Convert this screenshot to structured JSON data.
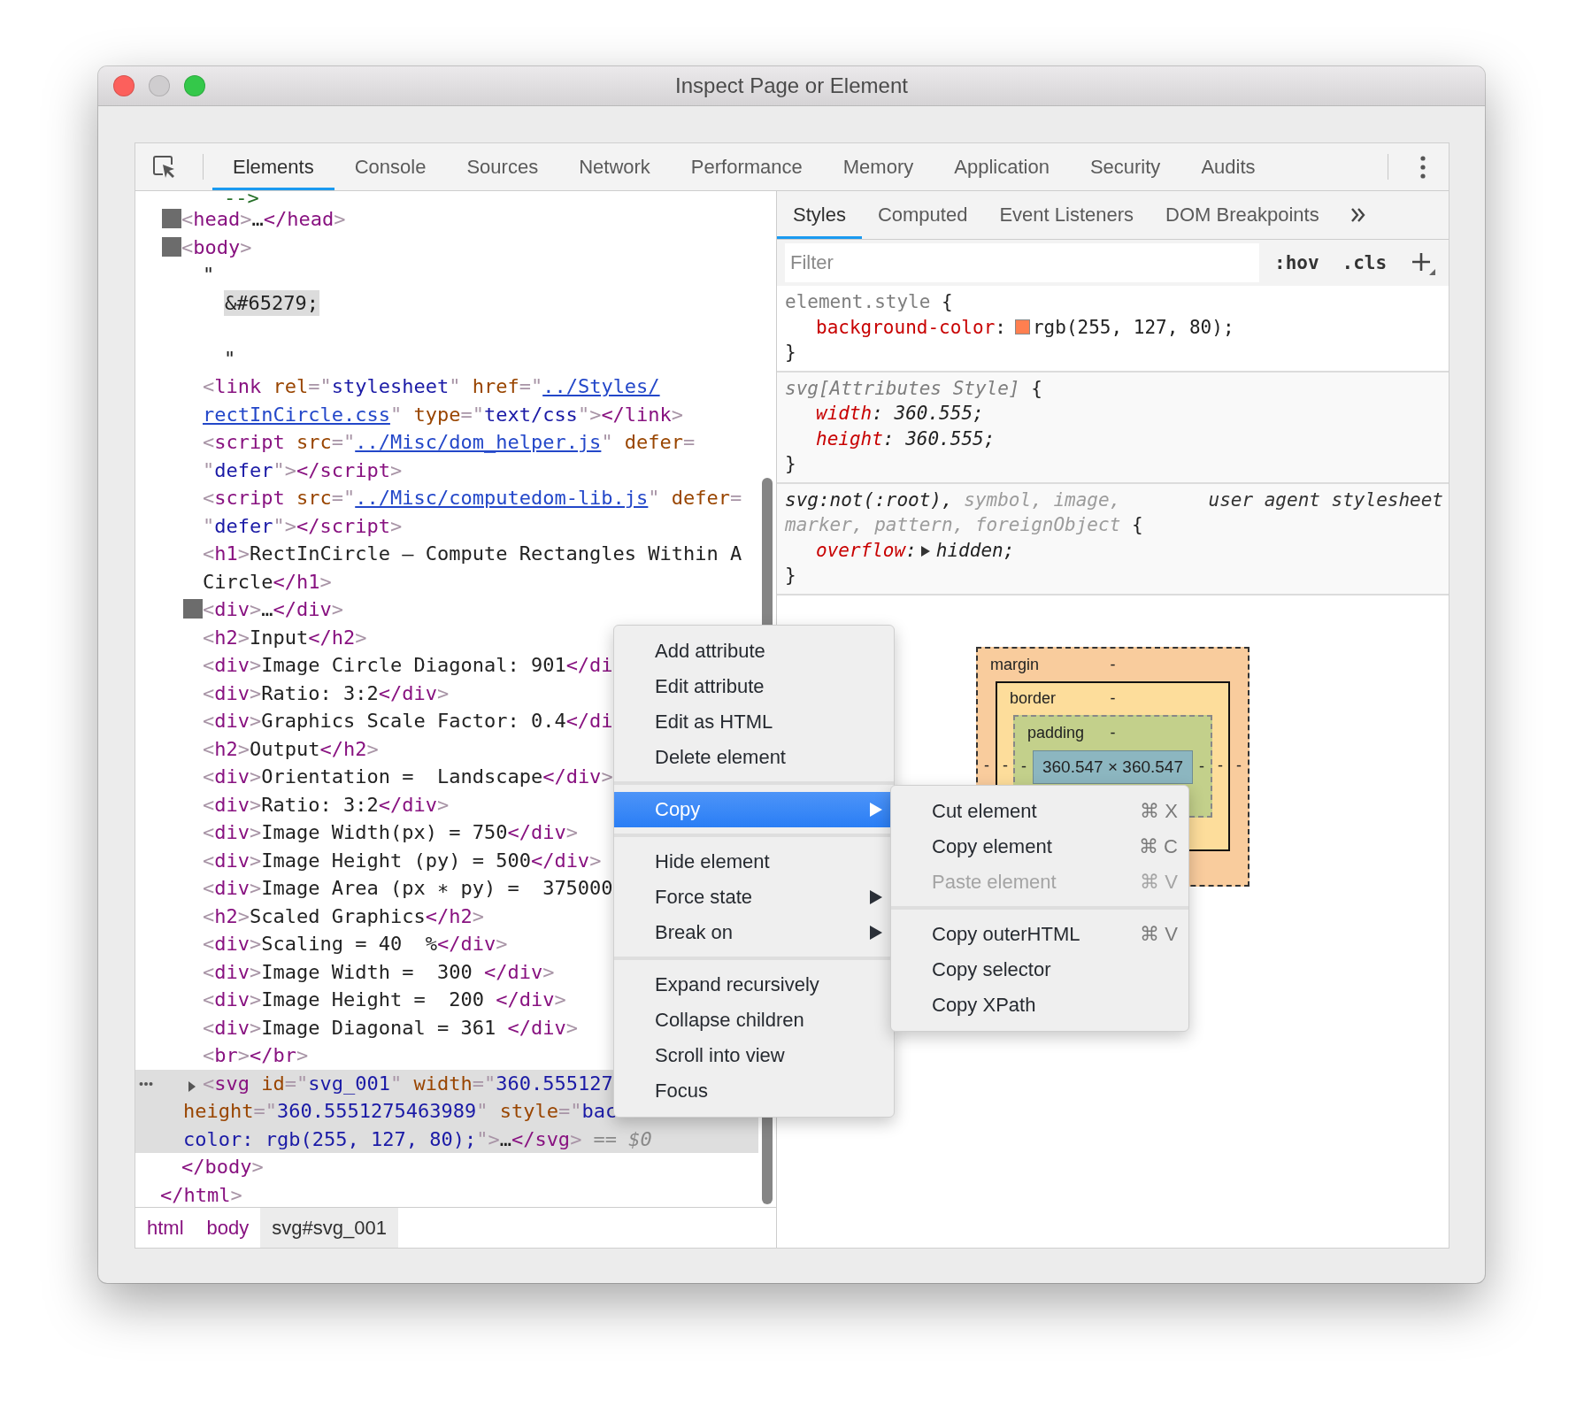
{
  "window": {
    "title": "Inspect Page or Element",
    "controls": [
      {
        "kind": "close",
        "disabled": false
      },
      {
        "kind": "minimize",
        "disabled": true
      },
      {
        "kind": "zoom",
        "disabled": false
      }
    ]
  },
  "main_tabs": [
    {
      "label": "Elements",
      "selected": true
    },
    {
      "label": "Console",
      "selected": false
    },
    {
      "label": "Sources",
      "selected": false
    },
    {
      "label": "Network",
      "selected": false
    },
    {
      "label": "Performance",
      "selected": false
    },
    {
      "label": "Memory",
      "selected": false
    },
    {
      "label": "Application",
      "selected": false
    },
    {
      "label": "Security",
      "selected": false
    },
    {
      "label": "Audits",
      "selected": false
    }
  ],
  "dom_tree": {
    "children": [
      {
        "selected": false,
        "tokens": [
          {
            "kind": "c",
            "text": "-->"
          }
        ]
      },
      {
        "toggle": {
          "kind": "square"
        },
        "selected": false,
        "tokens": [
          {
            "kind": "b",
            "text": "<"
          },
          {
            "kind": "tag",
            "text": "head"
          },
          {
            "kind": "b",
            "text": ">"
          },
          {
            "kind": "text",
            "text": "…"
          },
          {
            "kind": "tag",
            "text": "</head"
          },
          {
            "kind": "b",
            "text": ">"
          }
        ]
      },
      {
        "toggle": {
          "kind": "square"
        },
        "selected": false,
        "tokens": [
          {
            "kind": "b",
            "text": "<"
          },
          {
            "kind": "tag",
            "text": "body"
          },
          {
            "kind": "b",
            "text": ">"
          }
        ],
        "close": [
          {
            "kind": "tag",
            "text": "</body"
          },
          {
            "kind": "b",
            "text": ">"
          }
        ],
        "children": [
          {
            "selected": false,
            "tokens": [
              {
                "kind": "q",
                "text": "\""
              },
              {
                "kind": "br"
              },
              {
                "kind": "ent",
                "text": "&#65279;"
              },
              {
                "kind": "br"
              },
              {
                "kind": "br"
              },
              {
                "kind": "q2",
                "text": "\""
              }
            ]
          },
          {
            "selected": false,
            "tokens": [
              {
                "kind": "b",
                "text": "<"
              },
              {
                "kind": "tag",
                "text": "link"
              },
              {
                "kind": "attr",
                "text": " rel"
              },
              {
                "kind": "p",
                "text": "=\""
              },
              {
                "kind": "val",
                "text": "stylesheet"
              },
              {
                "kind": "p",
                "text": "\""
              },
              {
                "kind": "attr",
                "text": " href"
              },
              {
                "kind": "p",
                "text": "=\""
              },
              {
                "kind": "link",
                "text": "../Styles/"
              },
              {
                "kind": "br"
              },
              {
                "kind": "link",
                "text": "rectInCircle.css"
              },
              {
                "kind": "p",
                "text": "\""
              },
              {
                "kind": "attr",
                "text": " type"
              },
              {
                "kind": "p",
                "text": "=\""
              },
              {
                "kind": "val",
                "text": "text/css"
              },
              {
                "kind": "p",
                "text": "\""
              },
              {
                "kind": "b",
                "text": ">"
              },
              {
                "kind": "tag",
                "text": "</link"
              },
              {
                "kind": "b",
                "text": ">"
              }
            ]
          },
          {
            "selected": false,
            "tokens": [
              {
                "kind": "b",
                "text": "<"
              },
              {
                "kind": "tag",
                "text": "script"
              },
              {
                "kind": "attr",
                "text": " src"
              },
              {
                "kind": "p",
                "text": "=\""
              },
              {
                "kind": "link",
                "text": "../Misc/dom_helper.js"
              },
              {
                "kind": "p",
                "text": "\""
              },
              {
                "kind": "attr",
                "text": " defer"
              },
              {
                "kind": "p",
                "text": "="
              },
              {
                "kind": "br"
              },
              {
                "kind": "p",
                "text": "\""
              },
              {
                "kind": "val",
                "text": "defer"
              },
              {
                "kind": "p",
                "text": "\""
              },
              {
                "kind": "b",
                "text": ">"
              },
              {
                "kind": "tag",
                "text": "</script"
              },
              {
                "kind": "b",
                "text": ">"
              }
            ]
          },
          {
            "selected": false,
            "tokens": [
              {
                "kind": "b",
                "text": "<"
              },
              {
                "kind": "tag",
                "text": "script"
              },
              {
                "kind": "attr",
                "text": " src"
              },
              {
                "kind": "p",
                "text": "=\""
              },
              {
                "kind": "link",
                "text": "../Misc/computedom-lib.js"
              },
              {
                "kind": "p",
                "text": "\""
              },
              {
                "kind": "attr",
                "text": " defer"
              },
              {
                "kind": "p",
                "text": "="
              },
              {
                "kind": "br"
              },
              {
                "kind": "p",
                "text": "\""
              },
              {
                "kind": "val",
                "text": "defer"
              },
              {
                "kind": "p",
                "text": "\""
              },
              {
                "kind": "b",
                "text": ">"
              },
              {
                "kind": "tag",
                "text": "</script"
              },
              {
                "kind": "b",
                "text": ">"
              }
            ]
          },
          {
            "selected": false,
            "tokens": [
              {
                "kind": "b",
                "text": "<"
              },
              {
                "kind": "tag",
                "text": "h1"
              },
              {
                "kind": "b",
                "text": ">"
              },
              {
                "kind": "text",
                "text": "RectInCircle – Compute Rectangles Within A"
              },
              {
                "kind": "br"
              },
              {
                "kind": "text",
                "text": "Circle"
              },
              {
                "kind": "tag",
                "text": "</h1"
              },
              {
                "kind": "b",
                "text": ">"
              }
            ]
          },
          {
            "toggle": {
              "kind": "square"
            },
            "selected": false,
            "tokens": [
              {
                "kind": "b",
                "text": "<"
              },
              {
                "kind": "tag",
                "text": "div"
              },
              {
                "kind": "b",
                "text": ">"
              },
              {
                "kind": "text",
                "text": "…"
              },
              {
                "kind": "tag",
                "text": "</div"
              },
              {
                "kind": "b",
                "text": ">"
              }
            ]
          },
          {
            "selected": false,
            "tokens": [
              {
                "kind": "b",
                "text": "<"
              },
              {
                "kind": "tag",
                "text": "h2"
              },
              {
                "kind": "b",
                "text": ">"
              },
              {
                "kind": "text",
                "text": "Input"
              },
              {
                "kind": "tag",
                "text": "</h2"
              },
              {
                "kind": "b",
                "text": ">"
              }
            ]
          },
          {
            "selected": false,
            "tokens": [
              {
                "kind": "b",
                "text": "<"
              },
              {
                "kind": "tag",
                "text": "div"
              },
              {
                "kind": "b",
                "text": ">"
              },
              {
                "kind": "text",
                "text": "Image Circle Diagonal: 901"
              },
              {
                "kind": "tag",
                "text": "</di"
              }
            ]
          },
          {
            "selected": false,
            "tokens": [
              {
                "kind": "b",
                "text": "<"
              },
              {
                "kind": "tag",
                "text": "div"
              },
              {
                "kind": "b",
                "text": ">"
              },
              {
                "kind": "text",
                "text": "Ratio: 3:2"
              },
              {
                "kind": "tag",
                "text": "</div"
              },
              {
                "kind": "b",
                "text": ">"
              }
            ]
          },
          {
            "selected": false,
            "tokens": [
              {
                "kind": "b",
                "text": "<"
              },
              {
                "kind": "tag",
                "text": "div"
              },
              {
                "kind": "b",
                "text": ">"
              },
              {
                "kind": "text",
                "text": "Graphics Scale Factor: 0.4"
              },
              {
                "kind": "tag",
                "text": "</di"
              }
            ]
          },
          {
            "selected": false,
            "tokens": [
              {
                "kind": "b",
                "text": "<"
              },
              {
                "kind": "tag",
                "text": "h2"
              },
              {
                "kind": "b",
                "text": ">"
              },
              {
                "kind": "text",
                "text": "Output"
              },
              {
                "kind": "tag",
                "text": "</h2"
              },
              {
                "kind": "b",
                "text": ">"
              }
            ]
          },
          {
            "selected": false,
            "tokens": [
              {
                "kind": "b",
                "text": "<"
              },
              {
                "kind": "tag",
                "text": "div"
              },
              {
                "kind": "b",
                "text": ">"
              },
              {
                "kind": "text",
                "text": "Orientation =  Landscape"
              },
              {
                "kind": "tag",
                "text": "</div"
              },
              {
                "kind": "b",
                "text": ">"
              }
            ]
          },
          {
            "selected": false,
            "tokens": [
              {
                "kind": "b",
                "text": "<"
              },
              {
                "kind": "tag",
                "text": "div"
              },
              {
                "kind": "b",
                "text": ">"
              },
              {
                "kind": "text",
                "text": "Ratio: 3:2"
              },
              {
                "kind": "tag",
                "text": "</div"
              },
              {
                "kind": "b",
                "text": ">"
              }
            ]
          },
          {
            "selected": false,
            "tokens": [
              {
                "kind": "b",
                "text": "<"
              },
              {
                "kind": "tag",
                "text": "div"
              },
              {
                "kind": "b",
                "text": ">"
              },
              {
                "kind": "text",
                "text": "Image Width(px) = 750"
              },
              {
                "kind": "tag",
                "text": "</div"
              },
              {
                "kind": "b",
                "text": ">"
              }
            ]
          },
          {
            "selected": false,
            "tokens": [
              {
                "kind": "b",
                "text": "<"
              },
              {
                "kind": "tag",
                "text": "div"
              },
              {
                "kind": "b",
                "text": ">"
              },
              {
                "kind": "text",
                "text": "Image Height (py) = 500"
              },
              {
                "kind": "tag",
                "text": "</div"
              },
              {
                "kind": "b",
                "text": ">"
              }
            ]
          },
          {
            "selected": false,
            "tokens": [
              {
                "kind": "b",
                "text": "<"
              },
              {
                "kind": "tag",
                "text": "div"
              },
              {
                "kind": "b",
                "text": ">"
              },
              {
                "kind": "text",
                "text": "Image Area (px ∗ py) =  375000"
              }
            ]
          },
          {
            "selected": false,
            "tokens": [
              {
                "kind": "b",
                "text": "<"
              },
              {
                "kind": "tag",
                "text": "h2"
              },
              {
                "kind": "b",
                "text": ">"
              },
              {
                "kind": "text",
                "text": "Scaled Graphics"
              },
              {
                "kind": "tag",
                "text": "</h2"
              },
              {
                "kind": "b",
                "text": ">"
              }
            ]
          },
          {
            "selected": false,
            "tokens": [
              {
                "kind": "b",
                "text": "<"
              },
              {
                "kind": "tag",
                "text": "div"
              },
              {
                "kind": "b",
                "text": ">"
              },
              {
                "kind": "text",
                "text": "Scaling = 40  %"
              },
              {
                "kind": "tag",
                "text": "</div"
              },
              {
                "kind": "b",
                "text": ">"
              }
            ]
          },
          {
            "selected": false,
            "tokens": [
              {
                "kind": "b",
                "text": "<"
              },
              {
                "kind": "tag",
                "text": "div"
              },
              {
                "kind": "b",
                "text": ">"
              },
              {
                "kind": "text",
                "text": "Image Width =  300 "
              },
              {
                "kind": "tag",
                "text": "</div"
              },
              {
                "kind": "b",
                "text": ">"
              }
            ]
          },
          {
            "selected": false,
            "tokens": [
              {
                "kind": "b",
                "text": "<"
              },
              {
                "kind": "tag",
                "text": "div"
              },
              {
                "kind": "b",
                "text": ">"
              },
              {
                "kind": "text",
                "text": "Image Height =  200 "
              },
              {
                "kind": "tag",
                "text": "</div"
              },
              {
                "kind": "b",
                "text": ">"
              }
            ]
          },
          {
            "selected": false,
            "tokens": [
              {
                "kind": "b",
                "text": "<"
              },
              {
                "kind": "tag",
                "text": "div"
              },
              {
                "kind": "b",
                "text": ">"
              },
              {
                "kind": "text",
                "text": "Image Diagonal = 361 "
              },
              {
                "kind": "tag",
                "text": "</div"
              },
              {
                "kind": "b",
                "text": ">"
              }
            ]
          },
          {
            "selected": false,
            "tokens": [
              {
                "kind": "b",
                "text": "<"
              },
              {
                "kind": "tag",
                "text": "br"
              },
              {
                "kind": "b",
                "text": ">"
              },
              {
                "kind": "tag",
                "text": "</br"
              },
              {
                "kind": "b",
                "text": ">"
              }
            ]
          },
          {
            "toggle": {
              "kind": "triangle",
              "expanded": false
            },
            "selected": true,
            "tokens": [
              {
                "kind": "b",
                "text": "<"
              },
              {
                "kind": "tag",
                "text": "svg"
              },
              {
                "kind": "attr",
                "text": " id"
              },
              {
                "kind": "p",
                "text": "=\""
              },
              {
                "kind": "val",
                "text": "svg_001"
              },
              {
                "kind": "p",
                "text": "\""
              },
              {
                "kind": "attr",
                "text": " width"
              },
              {
                "kind": "p",
                "text": "=\""
              },
              {
                "kind": "val",
                "text": "360.555127"
              },
              {
                "kind": "br"
              },
              {
                "kind": "attr",
                "text": "height"
              },
              {
                "kind": "p",
                "text": "=\""
              },
              {
                "kind": "val",
                "text": "360.5551275463989"
              },
              {
                "kind": "p",
                "text": "\""
              },
              {
                "kind": "attr",
                "text": " style"
              },
              {
                "kind": "p",
                "text": "=\""
              },
              {
                "kind": "val",
                "text": "bac"
              },
              {
                "kind": "br"
              },
              {
                "kind": "val",
                "text": "color: rgb(255, 127, 80);"
              },
              {
                "kind": "p",
                "text": "\""
              },
              {
                "kind": "b",
                "text": ">"
              },
              {
                "kind": "text",
                "text": "…"
              },
              {
                "kind": "tag",
                "text": "</svg"
              },
              {
                "kind": "b",
                "text": ">"
              },
              {
                "kind": "muted",
                "text": " == $0"
              }
            ]
          }
        ]
      }
    ],
    "close": [
      {
        "kind": "tag",
        "text": "</html"
      },
      {
        "kind": "b",
        "text": ">"
      }
    ]
  },
  "breadcrumbs": [
    {
      "label": "html",
      "selected": false
    },
    {
      "label": "body",
      "selected": false
    },
    {
      "label": "svg#svg_001",
      "selected": true
    }
  ],
  "side_tabs": [
    {
      "label": "Styles",
      "selected": true
    },
    {
      "label": "Computed",
      "selected": false
    },
    {
      "label": "Event Listeners",
      "selected": false
    },
    {
      "label": "DOM Breakpoints",
      "selected": false
    }
  ],
  "filter": {
    "placeholder": "Filter",
    "hov": ":hov",
    "cls": ".cls"
  },
  "rules": [
    {
      "kind": "inline",
      "selector_lines": [
        [
          {
            "text": "element.style",
            "matched": true
          }
        ]
      ],
      "open": " {",
      "props": [
        {
          "name": "background-color",
          "colon": ":",
          "value": "rgb(255, 127, 80);",
          "color": "#ff7f50"
        }
      ],
      "close": "}"
    },
    {
      "kind": "attributes",
      "selector_lines": [
        [
          {
            "text": "svg[Attributes Style]",
            "matched": true
          }
        ]
      ],
      "open": " {",
      "props": [
        {
          "name": "width",
          "colon": ":",
          "value": "360.555;"
        },
        {
          "name": "height",
          "colon": ":",
          "value": "360.555;"
        }
      ],
      "close": "}"
    },
    {
      "kind": "user_agent",
      "source": "user agent stylesheet",
      "selector_lines": [
        [
          {
            "text": "svg:not(:root),",
            "matched": true
          },
          {
            "text": " symbol, image,",
            "matched": false
          }
        ],
        [
          {
            "text": "marker, pattern, foreignObject",
            "matched": false
          }
        ]
      ],
      "open": " {",
      "props": [
        {
          "name": "overflow",
          "colon": ":",
          "value": "hidden;",
          "expanded": false
        }
      ],
      "close": "}"
    }
  ],
  "box_model": {
    "margin": {
      "label": "margin",
      "top": "-",
      "left": "-",
      "right": "-"
    },
    "border": {
      "label": "border",
      "top": "-",
      "left": "-",
      "right": "-"
    },
    "padding": {
      "label": "padding",
      "top": "-",
      "left": "-",
      "right": "-"
    },
    "content": "360.547 × 360.547"
  },
  "context_menu": {
    "items": [
      {
        "kind": "item",
        "label": "Add attribute",
        "selected": false
      },
      {
        "kind": "item",
        "label": "Edit attribute",
        "selected": false
      },
      {
        "kind": "item",
        "label": "Edit as HTML",
        "selected": false
      },
      {
        "kind": "item",
        "label": "Delete element",
        "selected": false
      },
      {
        "kind": "separator"
      },
      {
        "kind": "submenu",
        "label": "Copy",
        "selected": true
      },
      {
        "kind": "separator"
      },
      {
        "kind": "item",
        "label": "Hide element",
        "selected": false
      },
      {
        "kind": "submenu",
        "label": "Force state",
        "selected": false
      },
      {
        "kind": "submenu",
        "label": "Break on",
        "selected": false
      },
      {
        "kind": "separator"
      },
      {
        "kind": "item",
        "label": "Expand recursively",
        "selected": false
      },
      {
        "kind": "item",
        "label": "Collapse children",
        "selected": false
      },
      {
        "kind": "item",
        "label": "Scroll into view",
        "selected": false
      },
      {
        "kind": "item",
        "label": "Focus",
        "selected": false
      }
    ]
  },
  "submenu": {
    "items": [
      {
        "kind": "item",
        "label": "Cut element",
        "shortcut": "⌘ X",
        "disabled": false
      },
      {
        "kind": "item",
        "label": "Copy element",
        "shortcut": "⌘ C",
        "disabled": false
      },
      {
        "kind": "item",
        "label": "Paste element",
        "shortcut": "⌘ V",
        "disabled": true
      },
      {
        "kind": "separator"
      },
      {
        "kind": "item",
        "label": "Copy outerHTML",
        "shortcut": "⌘ V",
        "disabled": false
      },
      {
        "kind": "item",
        "label": "Copy selector",
        "disabled": false
      },
      {
        "kind": "item",
        "label": "Copy XPath",
        "disabled": false
      }
    ]
  }
}
